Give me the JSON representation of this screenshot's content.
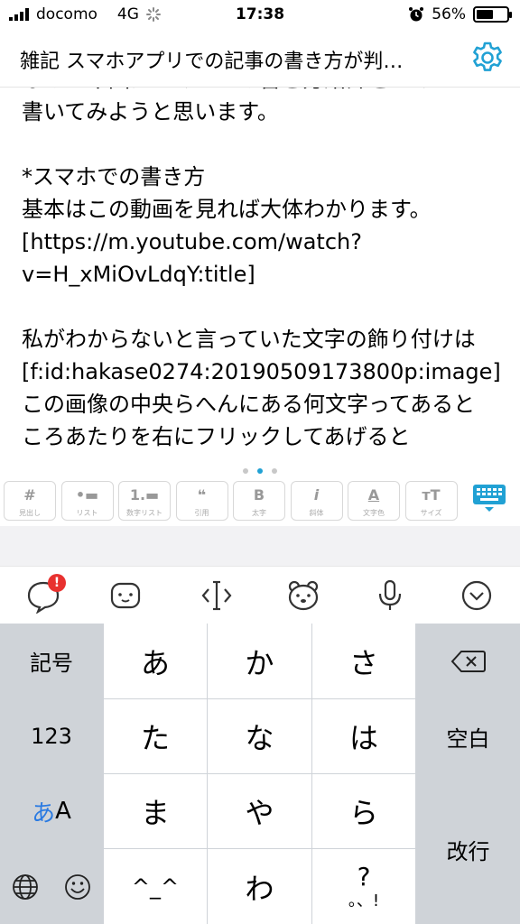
{
  "status_bar": {
    "carrier": "docomo",
    "network": "4G",
    "time": "17:38",
    "battery_percent": "56%",
    "battery_level": 0.56
  },
  "header": {
    "title": "雑記 スマホアプリでの記事の書き方が判…",
    "settings_icon": "gear-icon"
  },
  "editor": {
    "lines": [
      "なので今回はスマホでの書き方紹介をスマホで",
      "書いてみようと思います。",
      "",
      "*スマホでの書き方",
      "基本はこの動画を見れば大体わかります。",
      "[https://m.youtube.com/watch?",
      "v=H_xMiOvLdqY:title]",
      "",
      "私がわからないと言っていた文字の飾り付けは",
      "[f:id:hakase0274:20190509173800p:image]",
      "この画像の中央らへんにある何文字ってあると",
      "ころあたりを右にフリックしてあげると"
    ]
  },
  "format_toolbar": {
    "page_dots": 3,
    "active_page": 1,
    "buttons": [
      {
        "icon": "#",
        "label": "見出し"
      },
      {
        "icon": "•▬",
        "label": "リスト"
      },
      {
        "icon": "1.▬",
        "label": "数字リスト"
      },
      {
        "icon": "❝",
        "label": "引用"
      },
      {
        "icon": "B",
        "label": "太字"
      },
      {
        "icon": "i",
        "label": "斜体"
      },
      {
        "icon": "A",
        "label": "文字色"
      },
      {
        "icon": "ᴛT",
        "label": "サイズ"
      }
    ],
    "keyboard_toggle_icon": "keyboard-icon",
    "accent_color": "#21a1d4"
  },
  "keyboard_toolbar": {
    "badge": "!",
    "icons": [
      "chat-bubble-icon",
      "emoji-face-icon",
      "cursor-move-icon",
      "bear-icon",
      "microphone-icon",
      "chevron-down-circle-icon"
    ]
  },
  "keyboard": {
    "left_keys": [
      "記号",
      "123",
      "A"
    ],
    "kana_a_prefix": "あ",
    "kana_rows": [
      [
        "あ",
        "か",
        "さ"
      ],
      [
        "た",
        "な",
        "は"
      ],
      [
        "ま",
        "や",
        "ら"
      ],
      [
        "^_^",
        "わ",
        "?"
      ]
    ],
    "punct_line": "。、!",
    "space": "空白",
    "enter": "改行",
    "accent_color": "#2a7ae2"
  }
}
